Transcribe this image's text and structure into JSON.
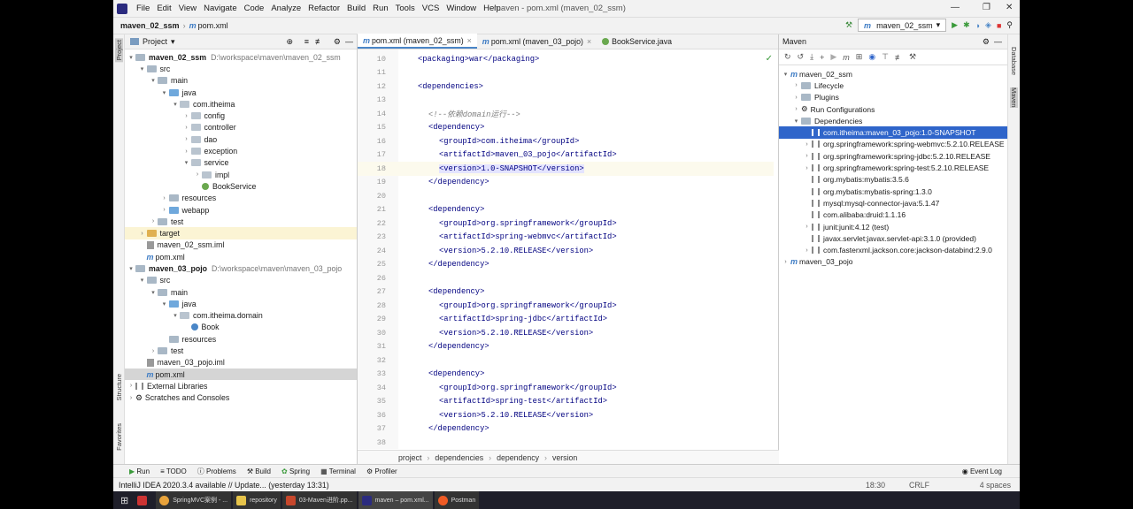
{
  "menu": {
    "items": [
      "File",
      "Edit",
      "View",
      "Navigate",
      "Code",
      "Analyze",
      "Refactor",
      "Build",
      "Run",
      "Tools",
      "VCS",
      "Window",
      "Help"
    ],
    "title": "maven - pom.xml (maven_02_ssm)"
  },
  "navbar": {
    "project": "maven_02_ssm",
    "file": "pom.xml"
  },
  "toolbar": {
    "run_config": "maven_02_ssm"
  },
  "left_strip": {
    "project": "Project",
    "structure": "Structure",
    "favorites": "Favorites"
  },
  "project_panel": {
    "title": "Project",
    "tree": [
      {
        "label": "maven_02_ssm",
        "path": "D:\\workspace\\maven\\maven_02_ssm",
        "indent": 0,
        "arrow": "▾",
        "icon": "folder",
        "bold": true
      },
      {
        "label": "src",
        "indent": 1,
        "arrow": "▾",
        "icon": "folder"
      },
      {
        "label": "main",
        "indent": 2,
        "arrow": "▾",
        "icon": "folder"
      },
      {
        "label": "java",
        "indent": 3,
        "arrow": "▾",
        "icon": "folder-blue"
      },
      {
        "label": "com.itheima",
        "indent": 4,
        "arrow": "▾",
        "icon": "package"
      },
      {
        "label": "config",
        "indent": 5,
        "arrow": "›",
        "icon": "package"
      },
      {
        "label": "controller",
        "indent": 5,
        "arrow": "›",
        "icon": "package"
      },
      {
        "label": "dao",
        "indent": 5,
        "arrow": "›",
        "icon": "package"
      },
      {
        "label": "exception",
        "indent": 5,
        "arrow": "›",
        "icon": "package"
      },
      {
        "label": "service",
        "indent": 5,
        "arrow": "▾",
        "icon": "package"
      },
      {
        "label": "impl",
        "indent": 6,
        "arrow": "›",
        "icon": "package"
      },
      {
        "label": "BookService",
        "indent": 6,
        "arrow": "",
        "icon": "interface"
      },
      {
        "label": "resources",
        "indent": 3,
        "arrow": "›",
        "icon": "folder"
      },
      {
        "label": "webapp",
        "indent": 3,
        "arrow": "›",
        "icon": "folder-blue"
      },
      {
        "label": "test",
        "indent": 2,
        "arrow": "›",
        "icon": "folder"
      },
      {
        "label": "target",
        "indent": 1,
        "arrow": "›",
        "icon": "folder-yellow",
        "highlight": true
      },
      {
        "label": "maven_02_ssm.iml",
        "indent": 1,
        "arrow": "",
        "icon": "iml"
      },
      {
        "label": "pom.xml",
        "indent": 1,
        "arrow": "",
        "icon": "maven"
      },
      {
        "label": "maven_03_pojo",
        "path": "D:\\workspace\\maven\\maven_03_pojo",
        "indent": 0,
        "arrow": "▾",
        "icon": "folder",
        "bold": true
      },
      {
        "label": "src",
        "indent": 1,
        "arrow": "▾",
        "icon": "folder"
      },
      {
        "label": "main",
        "indent": 2,
        "arrow": "▾",
        "icon": "folder"
      },
      {
        "label": "java",
        "indent": 3,
        "arrow": "▾",
        "icon": "folder-blue"
      },
      {
        "label": "com.itheima.domain",
        "indent": 4,
        "arrow": "▾",
        "icon": "package"
      },
      {
        "label": "Book",
        "indent": 5,
        "arrow": "",
        "icon": "class"
      },
      {
        "label": "resources",
        "indent": 3,
        "arrow": "",
        "icon": "folder"
      },
      {
        "label": "test",
        "indent": 2,
        "arrow": "›",
        "icon": "folder"
      },
      {
        "label": "maven_03_pojo.iml",
        "indent": 1,
        "arrow": "",
        "icon": "iml"
      },
      {
        "label": "pom.xml",
        "indent": 1,
        "arrow": "",
        "icon": "maven",
        "selected": true
      },
      {
        "label": "External Libraries",
        "indent": 0,
        "arrow": "›",
        "icon": "lib"
      },
      {
        "label": "Scratches and Consoles",
        "indent": 0,
        "arrow": "›",
        "icon": "scratch"
      }
    ]
  },
  "editor": {
    "tabs": [
      {
        "label": "pom.xml (maven_02_ssm)",
        "active": true
      },
      {
        "label": "pom.xml (maven_03_pojo)",
        "active": false
      },
      {
        "label": "BookService.java",
        "active": false
      }
    ],
    "lines": [
      {
        "n": "10",
        "indent": 1,
        "text": "<packaging>war</packaging>",
        "kind": "tag"
      },
      {
        "n": "11",
        "indent": 0,
        "text": "",
        "kind": "tag"
      },
      {
        "n": "12",
        "indent": 1,
        "text": "<dependencies>",
        "kind": "tag"
      },
      {
        "n": "13",
        "indent": 0,
        "text": "",
        "kind": "tag"
      },
      {
        "n": "14",
        "indent": 2,
        "text": "<!--依赖domain运行-->",
        "kind": "comment"
      },
      {
        "n": "15",
        "indent": 2,
        "text": "<dependency>",
        "kind": "tag"
      },
      {
        "n": "16",
        "indent": 3,
        "text": "<groupId>com.itheima</groupId>",
        "kind": "tag"
      },
      {
        "n": "17",
        "indent": 3,
        "text": "<artifactId>maven_03_pojo</artifactId>",
        "kind": "tag"
      },
      {
        "n": "18",
        "indent": 3,
        "text": "<version>1.0-SNAPSHOT</version>",
        "kind": "tag",
        "current": true
      },
      {
        "n": "19",
        "indent": 2,
        "text": "</dependency>",
        "kind": "tag"
      },
      {
        "n": "20",
        "indent": 0,
        "text": "",
        "kind": "tag"
      },
      {
        "n": "21",
        "indent": 2,
        "text": "<dependency>",
        "kind": "tag"
      },
      {
        "n": "22",
        "indent": 3,
        "text": "<groupId>org.springframework</groupId>",
        "kind": "tag"
      },
      {
        "n": "23",
        "indent": 3,
        "text": "<artifactId>spring-webmvc</artifactId>",
        "kind": "tag"
      },
      {
        "n": "24",
        "indent": 3,
        "text": "<version>5.2.10.RELEASE</version>",
        "kind": "tag"
      },
      {
        "n": "25",
        "indent": 2,
        "text": "</dependency>",
        "kind": "tag"
      },
      {
        "n": "26",
        "indent": 0,
        "text": "",
        "kind": "tag"
      },
      {
        "n": "27",
        "indent": 2,
        "text": "<dependency>",
        "kind": "tag"
      },
      {
        "n": "28",
        "indent": 3,
        "text": "<groupId>org.springframework</groupId>",
        "kind": "tag"
      },
      {
        "n": "29",
        "indent": 3,
        "text": "<artifactId>spring-jdbc</artifactId>",
        "kind": "tag"
      },
      {
        "n": "30",
        "indent": 3,
        "text": "<version>5.2.10.RELEASE</version>",
        "kind": "tag"
      },
      {
        "n": "31",
        "indent": 2,
        "text": "</dependency>",
        "kind": "tag"
      },
      {
        "n": "32",
        "indent": 0,
        "text": "",
        "kind": "tag"
      },
      {
        "n": "33",
        "indent": 2,
        "text": "<dependency>",
        "kind": "tag"
      },
      {
        "n": "34",
        "indent": 3,
        "text": "<groupId>org.springframework</groupId>",
        "kind": "tag"
      },
      {
        "n": "35",
        "indent": 3,
        "text": "<artifactId>spring-test</artifactId>",
        "kind": "tag"
      },
      {
        "n": "36",
        "indent": 3,
        "text": "<version>5.2.10.RELEASE</version>",
        "kind": "tag"
      },
      {
        "n": "37",
        "indent": 2,
        "text": "</dependency>",
        "kind": "tag"
      },
      {
        "n": "38",
        "indent": 0,
        "text": "",
        "kind": "tag"
      }
    ],
    "breadcrumb": [
      "project",
      "dependencies",
      "dependency",
      "version"
    ]
  },
  "maven_panel": {
    "title": "Maven",
    "tree": [
      {
        "label": "maven_02_ssm",
        "indent": 0,
        "arrow": "▾",
        "icon": "maven"
      },
      {
        "label": "Lifecycle",
        "indent": 1,
        "arrow": "›",
        "icon": "folder"
      },
      {
        "label": "Plugins",
        "indent": 1,
        "arrow": "›",
        "icon": "folder"
      },
      {
        "label": "Run Configurations",
        "indent": 1,
        "arrow": "›",
        "icon": "gear"
      },
      {
        "label": "Dependencies",
        "indent": 1,
        "arrow": "▾",
        "icon": "folder"
      },
      {
        "label": "com.itheima:maven_03_pojo:1.0-SNAPSHOT",
        "indent": 2,
        "arrow": "",
        "icon": "lib",
        "selected": true
      },
      {
        "label": "org.springframework:spring-webmvc:5.2.10.RELEASE",
        "indent": 2,
        "arrow": "›",
        "icon": "lib"
      },
      {
        "label": "org.springframework:spring-jdbc:5.2.10.RELEASE",
        "indent": 2,
        "arrow": "›",
        "icon": "lib"
      },
      {
        "label": "org.springframework:spring-test:5.2.10.RELEASE",
        "indent": 2,
        "arrow": "›",
        "icon": "lib"
      },
      {
        "label": "org.mybatis:mybatis:3.5.6",
        "indent": 2,
        "arrow": "",
        "icon": "lib"
      },
      {
        "label": "org.mybatis:mybatis-spring:1.3.0",
        "indent": 2,
        "arrow": "",
        "icon": "lib"
      },
      {
        "label": "mysql:mysql-connector-java:5.1.47",
        "indent": 2,
        "arrow": "",
        "icon": "lib"
      },
      {
        "label": "com.alibaba:druid:1.1.16",
        "indent": 2,
        "arrow": "",
        "icon": "lib"
      },
      {
        "label": "junit:junit:4.12 (test)",
        "indent": 2,
        "arrow": "›",
        "icon": "lib"
      },
      {
        "label": "javax.servlet:javax.servlet-api:3.1.0 (provided)",
        "indent": 2,
        "arrow": "",
        "icon": "lib"
      },
      {
        "label": "com.fasterxml.jackson.core:jackson-databind:2.9.0",
        "indent": 2,
        "arrow": "›",
        "icon": "lib"
      },
      {
        "label": "maven_03_pojo",
        "indent": 0,
        "arrow": "›",
        "icon": "maven"
      }
    ]
  },
  "right_strip": {
    "database": "Database",
    "maven": "Maven"
  },
  "bottom_tools": [
    "Run",
    "TODO",
    "Problems",
    "Build",
    "Spring",
    "Terminal",
    "Profiler"
  ],
  "event_log": "Event Log",
  "status": {
    "message": "IntelliJ IDEA 2020.3.4 available // Update... (yesterday 13:31)",
    "position": "18:30",
    "eol": "CRLF",
    "indent": "4 spaces"
  },
  "taskbar": [
    "SpringMVC案例 - ...",
    "repository",
    "03-Maven进阶.pp...",
    "maven – pom.xml...",
    "Postman"
  ],
  "colors": {
    "accent": "#2f65ca",
    "tag": "#000080",
    "comment": "#808080",
    "highlight": "#fbf4d4"
  }
}
